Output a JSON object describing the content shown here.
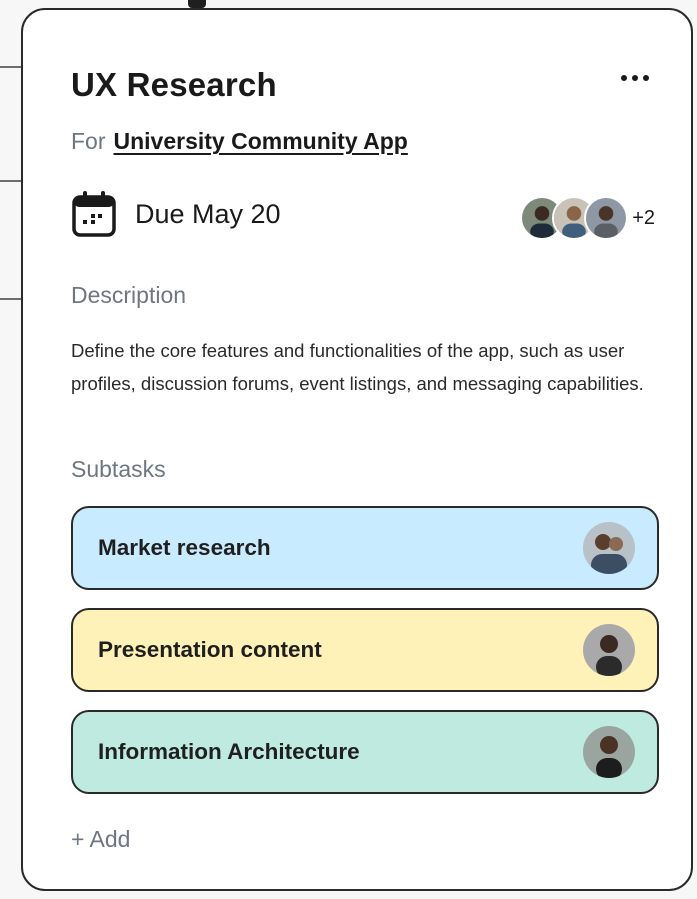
{
  "card": {
    "title": "UX Research",
    "for_prefix": "For",
    "project_name": "University Community App",
    "due_label": "Due May 20",
    "extra_assignees": "+2",
    "description_heading": "Description",
    "description_text": "Define the core features and functionalities of the app, such as user profiles, discussion forums, event listings, and messaging capabilities.",
    "subtasks_heading": "Subtasks",
    "subtasks": [
      {
        "label": "Market research",
        "color": "#c9ebff"
      },
      {
        "label": "Presentation content",
        "color": "#fff2b8"
      },
      {
        "label": "Information Architecture",
        "color": "#bfeadf"
      }
    ],
    "add_label": "+ Add"
  },
  "colors": {
    "card_border": "#2a2a2a",
    "muted_text": "#6e7681",
    "primary_text": "#1a1a1a"
  },
  "icons": {
    "more": "more-horizontal-icon",
    "calendar": "calendar-icon"
  }
}
